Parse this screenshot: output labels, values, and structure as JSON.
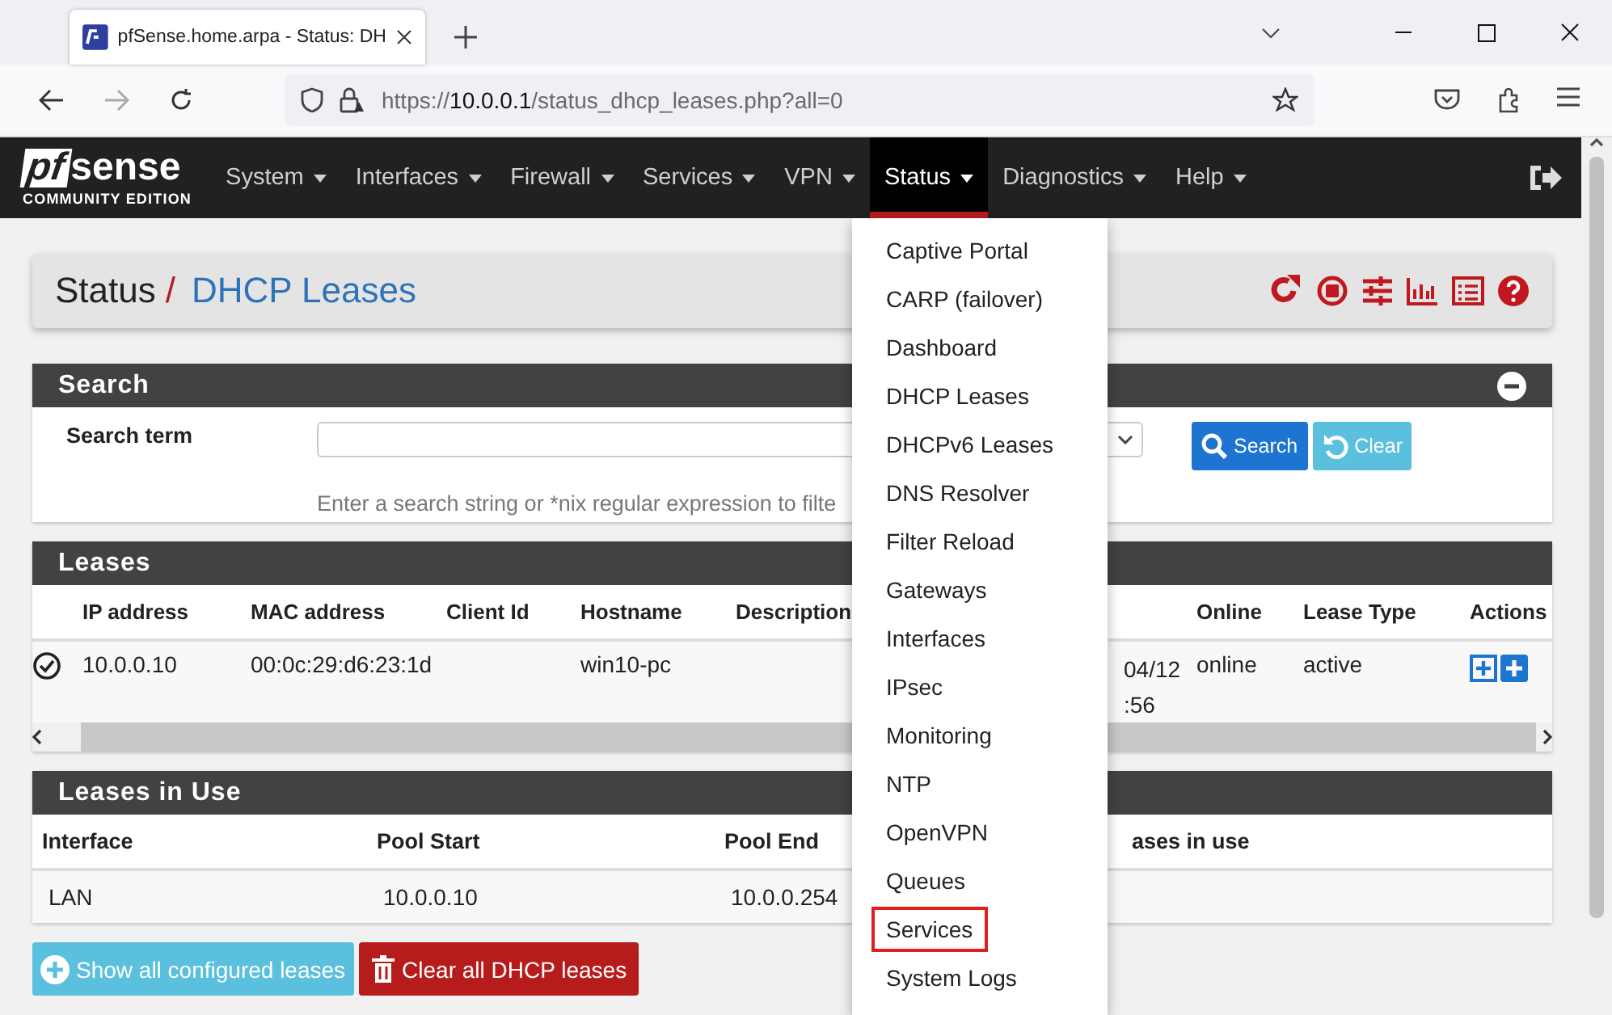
{
  "browser": {
    "tab": {
      "title": "pfSense.home.arpa - Status: DH"
    },
    "url": {
      "prefix": "https://",
      "host": "10.0.0.1",
      "path": "/status_dhcp_leases.php?all=0"
    }
  },
  "navbar": {
    "logo": {
      "mark": "pf",
      "word": "sense",
      "edition": "COMMUNITY EDITION"
    },
    "items": [
      {
        "label": "System",
        "selected": false
      },
      {
        "label": "Interfaces",
        "selected": false
      },
      {
        "label": "Firewall",
        "selected": false
      },
      {
        "label": "Services",
        "selected": false
      },
      {
        "label": "VPN",
        "selected": false
      },
      {
        "label": "Status",
        "selected": true
      },
      {
        "label": "Diagnostics",
        "selected": false
      },
      {
        "label": "Help",
        "selected": false
      }
    ]
  },
  "breadcrumb": {
    "parent": "Status",
    "separator": "/",
    "current": "DHCP Leases"
  },
  "search_panel": {
    "title": "Search",
    "label": "Search term",
    "help": "Enter a search string or *nix regular expression to filte",
    "buttons": [
      {
        "kind": "search",
        "label": "Search"
      },
      {
        "kind": "clear",
        "label": "Clear"
      }
    ]
  },
  "leases_panel": {
    "title": "Leases",
    "columns": [
      "IP address",
      "MAC address",
      "Client Id",
      "Hostname",
      "Description",
      "Online",
      "Lease Type",
      "Actions"
    ],
    "rows": [
      {
        "ip": "10.0.0.10",
        "mac": "00:0c:29:d6:23:1d",
        "client_id": "",
        "hostname": "win10-pc",
        "description": "",
        "column_7": [
          "04/12",
          ":56"
        ],
        "online": "online",
        "lease_type": "active"
      }
    ]
  },
  "in_use_panel": {
    "title": "Leases in Use",
    "columns": [
      "Interface",
      "Pool Start",
      "Pool End",
      "ases in use"
    ],
    "rows": [
      {
        "interface": "LAN",
        "pool_start": "10.0.0.10",
        "pool_end": "10.0.0.254"
      }
    ]
  },
  "actions": [
    {
      "kind": "show",
      "label": "Show all configured leases"
    },
    {
      "kind": "clear",
      "label": "Clear all DHCP leases"
    }
  ],
  "status_menu": {
    "items": [
      {
        "label": "Captive Portal",
        "highlighted": false
      },
      {
        "label": "CARP (failover)",
        "highlighted": false
      },
      {
        "label": "Dashboard",
        "highlighted": false
      },
      {
        "label": "DHCP Leases",
        "highlighted": false
      },
      {
        "label": "DHCPv6 Leases",
        "highlighted": false
      },
      {
        "label": "DNS Resolver",
        "highlighted": false
      },
      {
        "label": "Filter Reload",
        "highlighted": false
      },
      {
        "label": "Gateways",
        "highlighted": false
      },
      {
        "label": "Interfaces",
        "highlighted": false
      },
      {
        "label": "IPsec",
        "highlighted": false
      },
      {
        "label": "Monitoring",
        "highlighted": false
      },
      {
        "label": "NTP",
        "highlighted": false
      },
      {
        "label": "OpenVPN",
        "highlighted": false
      },
      {
        "label": "Queues",
        "highlighted": false
      },
      {
        "label": "Services",
        "highlighted": true
      },
      {
        "label": "System Logs",
        "highlighted": false
      }
    ]
  }
}
